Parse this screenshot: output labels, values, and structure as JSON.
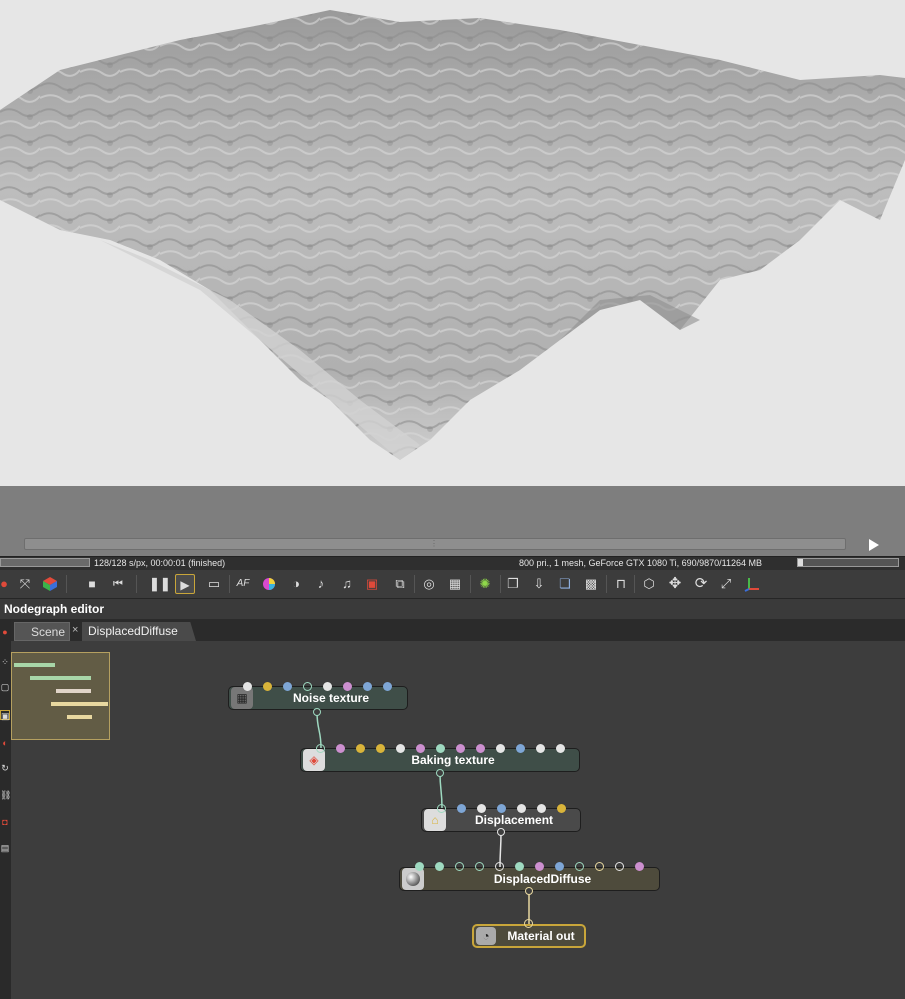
{
  "status": {
    "left": "128/128 s/px, 00:00:01 (finished)",
    "right": "800 pri., 1 mesh, GeForce GTX 1080 Ti, 690/9870/11264 MB"
  },
  "toolbar": {
    "icons": [
      "reset-camera-icon",
      "fit-icon",
      "render-cube-icon",
      "stop-icon",
      "restart-icon",
      "pause-icon",
      "play-icon",
      "screen-icon",
      "af-icon",
      "color-wheel-icon",
      "material-icon",
      "fx-icon",
      "light-icon",
      "red-box-icon",
      "region-icon",
      "zoom-icon",
      "grid-icon",
      "spinner-icon",
      "copy-icon",
      "save-icon",
      "layers-icon",
      "checker-icon",
      "lock-icon",
      "cube-icon",
      "move-icon",
      "rotate-icon",
      "scale-icon",
      "axis-icon"
    ]
  },
  "nodegraph": {
    "title": "Nodegraph editor",
    "tabs": [
      "Scene",
      "DisplacedDiffuse"
    ],
    "tab_close": "×",
    "nodes": [
      {
        "name": "Noise texture"
      },
      {
        "name": "Baking texture"
      },
      {
        "name": "Displacement"
      },
      {
        "name": "DisplacedDiffuse"
      },
      {
        "name": "Material out"
      }
    ]
  },
  "colors": {
    "texture_node": "#3f4e48",
    "material_node": "#4e4b3c",
    "pin_yellow": "#d9b43a",
    "pin_blue": "#7ea6d6",
    "pin_white": "#e5e5e5",
    "pin_pink": "#cc8fcf",
    "pin_green": "#9ed9c0",
    "selected_border": "#c9a63a"
  }
}
